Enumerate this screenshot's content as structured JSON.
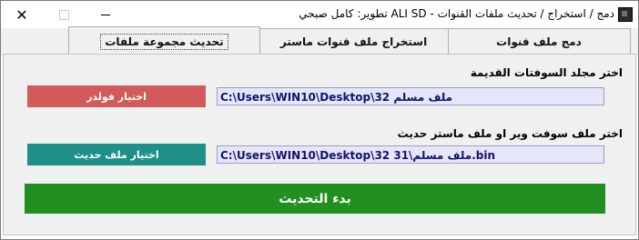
{
  "window": {
    "title": "دمج / استخراج / تحديث ملفات القنوات - ALI SD تطوير: كامل صبحي",
    "close_glyph": "✕"
  },
  "tabs": [
    {
      "label": "دمج ملف قنوات",
      "selected": false
    },
    {
      "label": "استخراج ملف قنوات ماستر",
      "selected": false
    },
    {
      "label": "تحديث مجموعة ملفات",
      "selected": true
    }
  ],
  "section_old": {
    "label": "اختر مجلد السوفتات القديمة",
    "path": "C:\\Users\\WIN10\\Desktop\\32 ملف مسلم",
    "button_label": "اختيار فولدر",
    "button_color": "#d25a5a"
  },
  "section_new": {
    "label": "اختر ملف سوفت وير او ملف ماستر حديث",
    "path": "C:\\Users\\WIN10\\Desktop\\32 ملف مسلم\\31.bin",
    "button_label": "اختيار ملف حديث",
    "button_color": "#1f8f8a"
  },
  "start": {
    "label": "بدء التحديث",
    "color": "#219020"
  }
}
